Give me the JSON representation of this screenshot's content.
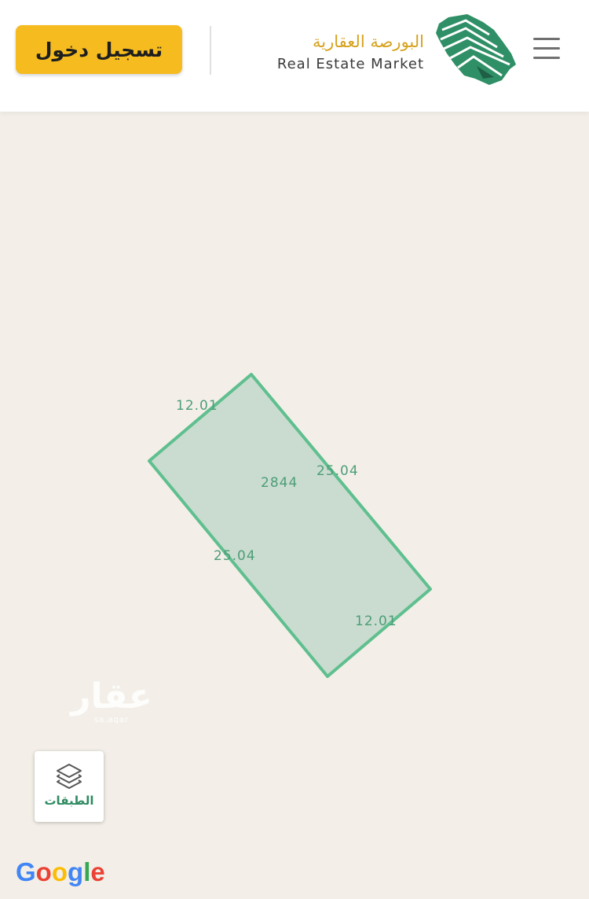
{
  "header": {
    "login_label": "تسجيل دخول",
    "brand_name_ar": "البورصة العقارية",
    "brand_name_en": "Real Estate Market",
    "logo_icon": "saudi-map-logo-icon",
    "menu_icon": "hamburger-menu-icon",
    "accent_color": "#f5bb1f",
    "brand_color": "#d6a21d"
  },
  "map": {
    "background_color": "#f3efe8",
    "parcel": {
      "fill_color": "#c9dccf",
      "stroke_color": "#5fbf8f",
      "area_label": "2844",
      "edge_labels": {
        "top": "12.01",
        "right": "25.04",
        "left": "25.04",
        "bottom": "12.01"
      }
    },
    "watermark": {
      "text": "عقار",
      "subtext": "sa.aqar"
    },
    "layers_button": {
      "label": "الطبقات",
      "icon": "layers-icon"
    },
    "attribution": {
      "letters": [
        "G",
        "o",
        "o",
        "g",
        "l",
        "e"
      ],
      "colors": [
        "#4285f4",
        "#ea4335",
        "#fbbc05",
        "#4285f4",
        "#34a853",
        "#ea4335"
      ]
    }
  }
}
